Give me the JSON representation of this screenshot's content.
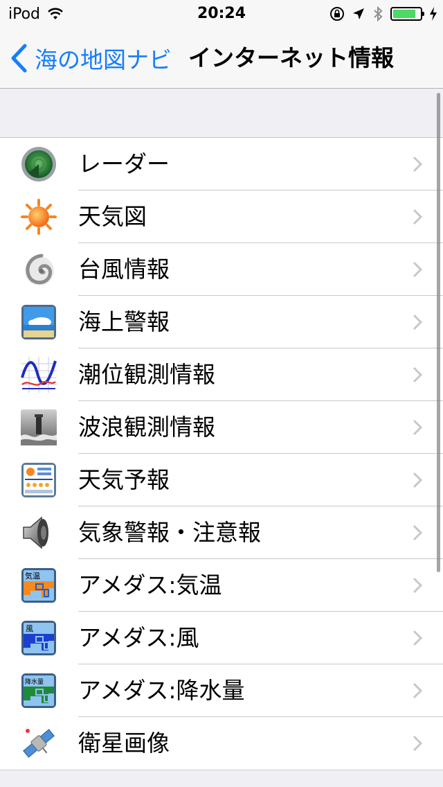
{
  "status_bar": {
    "carrier": "iPod",
    "time": "20:24",
    "battery_level": 0.85
  },
  "nav": {
    "back_label": "海の地図ナビ",
    "title": "インターネット情報"
  },
  "colors": {
    "accent": "#157efb",
    "battery": "#4cd964"
  },
  "list": {
    "items": [
      {
        "label": "レーダー",
        "icon": "radar-icon"
      },
      {
        "label": "天気図",
        "icon": "sun-icon"
      },
      {
        "label": "台風情報",
        "icon": "typhoon-icon"
      },
      {
        "label": "海上警報",
        "icon": "sea-icon"
      },
      {
        "label": "潮位観測情報",
        "icon": "tide-graph-icon"
      },
      {
        "label": "波浪観測情報",
        "icon": "lighthouse-icon"
      },
      {
        "label": "天気予報",
        "icon": "forecast-icon"
      },
      {
        "label": "気象警報・注意報",
        "icon": "speaker-icon"
      },
      {
        "label": "アメダス:気温",
        "icon": "amedas-temperature-icon",
        "icon_text": "気温"
      },
      {
        "label": "アメダス:風",
        "icon": "amedas-wind-icon",
        "icon_text": "風"
      },
      {
        "label": "アメダス:降水量",
        "icon": "amedas-rain-icon",
        "icon_text": "降水量"
      },
      {
        "label": "衛星画像",
        "icon": "satellite-icon"
      }
    ]
  }
}
